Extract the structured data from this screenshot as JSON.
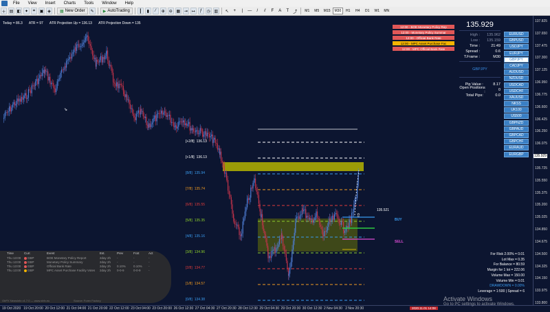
{
  "menu": [
    "File",
    "View",
    "Insert",
    "Charts",
    "Tools",
    "Window",
    "Help"
  ],
  "toolbar": {
    "new_order": "New Order",
    "autotrading": "AutoTrading",
    "timeframes": [
      "M1",
      "M5",
      "M15",
      "M30",
      "H1",
      "H4",
      "D1",
      "W1",
      "MN"
    ],
    "active_timeframe": "M30"
  },
  "hud": {
    "today": "Today = 86.3",
    "atr": "ATR = 97",
    "atr_up": "ATR Projection Up = 136.13",
    "atr_down": "ATR Projection Down = 135"
  },
  "news_buttons": [
    {
      "label": "12:00 - BOE Monetary Policy Rep",
      "color": "#e05757"
    },
    {
      "label": "12:00 - Monetary Policy Summar",
      "color": "#e05757"
    },
    {
      "label": "12:00 - Official Bank Rate",
      "color": "#e05757"
    },
    {
      "label": "12:00 - MPC Asset Purchase Fac",
      "color": "#f4b400"
    },
    {
      "label": "12:00 - MPC Official Bank Rate",
      "color": "#e05757"
    }
  ],
  "info": {
    "price": "135.929",
    "high_label": "High :",
    "high": "135.962",
    "low_label": "Low :",
    "low": "135.159",
    "time_label": "Time :",
    "time": "21:49",
    "spread_label": "Spread :",
    "spread": "0.6",
    "tframe_label": "T.Frame :",
    "tframe": "M30",
    "symbol": "GBPJPY",
    "pip_value_label": "Pip Value :",
    "pip_value": "8.17",
    "open_positions_label": "Open Positions :",
    "open_positions": "0",
    "total_pips_label": "Total Pips:",
    "total_pips": "0.0"
  },
  "symbols": [
    "EURUSD",
    "GBPUSD",
    "USDJPY",
    "EURJPY",
    "GBPJPY",
    "CADJPY",
    "AUDUSD",
    "NZDUSD",
    "USDCAD",
    "USDCHF",
    "XAUUSD",
    "NKSS",
    "UK100",
    "US500",
    "GBPNZD",
    "GBPAUD",
    "GBPCAD",
    "GBPCHF",
    "EURAUD",
    "EURGBP"
  ],
  "selected_symbol": "GBPJPY",
  "risk": {
    "for_risk": "For Risk 2.00% = 0.01",
    "lot_max": "Lot Max = 0.35",
    "for_balance": "For Balance = 80.59",
    "margin": "Margin for 1 lot = 222.06",
    "volume_max": "Volume Max = 150.00",
    "volume_min": "Volume Min = 0.01",
    "drawdown": "DRAWDOWN = 0.00%",
    "leverage": "Leverage = 1:500 | Spread = 6"
  },
  "calendar": {
    "headers": [
      "Time",
      "Curr.",
      "Event",
      "Est.",
      "Prev",
      "Fcst",
      "Act"
    ],
    "rows": [
      {
        "time": "Thu 13:00",
        "curr": "GBP",
        "event": "BOE Monetary Policy Report",
        "est": "2day 2h",
        "prev": "-",
        "fcst": "-",
        "act": "-",
        "dot": "#e05757"
      },
      {
        "time": "Thu 13:00",
        "curr": "GBP",
        "event": "Monetary Policy Summary",
        "est": "2day 2h",
        "prev": "-",
        "fcst": "-",
        "act": "-",
        "dot": "#e05757"
      },
      {
        "time": "Thu 13:00",
        "curr": "GBP",
        "event": "Official Bank Rate",
        "est": "2day 2h",
        "prev": "0.10%",
        "fcst": "0.10%",
        "act": "-",
        "dot": "#e05757"
      },
      {
        "time": "Thu 13:00",
        "curr": "GBP",
        "event": "MPC Asset Purchase Facility Votes",
        "est": "2day 2h",
        "prev": "0-0-9",
        "fcst": "0-0-9",
        "act": "-",
        "dot": "#f4b400"
      }
    ],
    "footer_left": "GbPX NewsInfo v1.7.0  —  www.xbfx.eu",
    "footer_right": "Source: Forex Factory"
  },
  "fib_levels": [
    {
      "label": "[+2/8]",
      "price": "136.13",
      "color": "#ffffff"
    },
    {
      "label": "[+1/8]",
      "price": "136.13",
      "color": "#ffffff"
    },
    {
      "label": "[8/8]",
      "price": "135.94",
      "color": "#3a9cf0"
    },
    {
      "label": "[7/8]",
      "price": "135.74",
      "color": "#f29b1f"
    },
    {
      "label": "[6/8]",
      "price": "135.55",
      "color": "#e03c3c"
    },
    {
      "label": "[5/8]",
      "price": "135.35",
      "color": "#8fd12a"
    },
    {
      "label": "[4/8]",
      "price": "135.16",
      "color": "#3a9cf0"
    },
    {
      "label": "[3/8]",
      "price": "134.96",
      "color": "#8fd12a"
    },
    {
      "label": "[2/8]",
      "price": "134.77",
      "color": "#e03c3c"
    },
    {
      "label": "[1/8]",
      "price": "134.57",
      "color": "#f29b1f"
    },
    {
      "label": "[0/8]",
      "price": "134.38",
      "color": "#3a9cf0"
    }
  ],
  "chart_marks": {
    "price_marker": "135.521",
    "buy": "BUY",
    "sell": "SELL",
    "bid_tag": "135.929",
    "red_tag": "2020.11.01 14:08"
  },
  "y_axis": [
    "137.825",
    "137.650",
    "137.475",
    "137.300",
    "137.125",
    "136.950",
    "136.775",
    "136.600",
    "136.425",
    "136.250",
    "136.075",
    "135.929",
    "135.725",
    "135.550",
    "135.375",
    "135.200",
    "135.025",
    "134.850",
    "134.675",
    "134.500",
    "134.325",
    "134.150",
    "133.975",
    "133.800"
  ],
  "x_axis": [
    "19 Oct 2020",
    "19 Oct 20:00",
    "20 Oct 12:00",
    "21 Oct 04:00",
    "21 Oct 20:00",
    "22 Oct 12:00",
    "23 Oct 04:00",
    "23 Oct 20:00",
    "26 Oct 12:30",
    "27 Oct 04:30",
    "27 Oct 20:30",
    "28 Oct 12:30",
    "29 Oct 04:30",
    "29 Oct 20:30",
    "30 Oct 12:30",
    "2 Nov 04:30",
    "2 Nov 20:30"
  ],
  "watermark": {
    "title": "Activate Windows",
    "sub": "Go to PC settings to activate Windows."
  }
}
